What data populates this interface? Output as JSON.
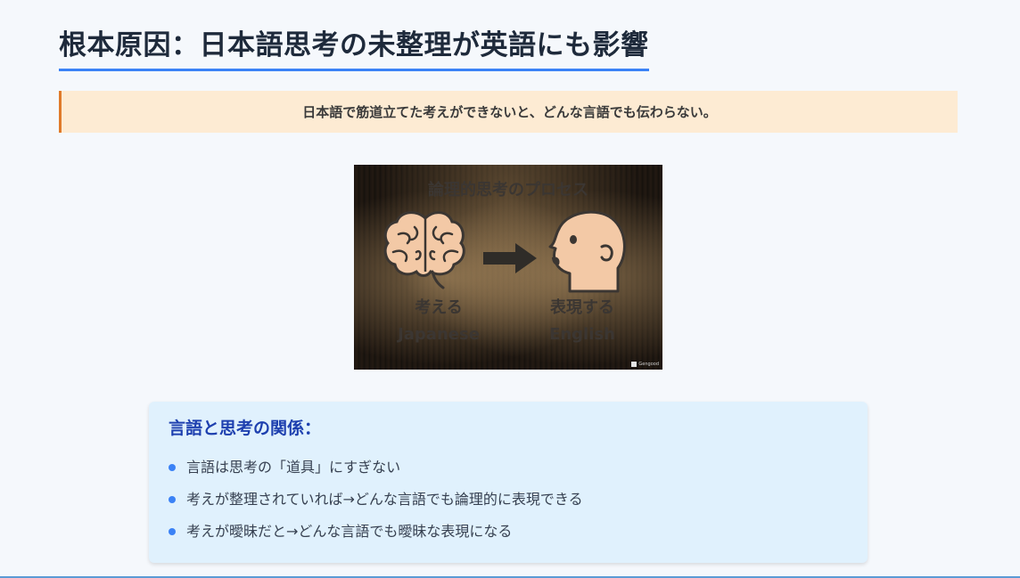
{
  "slide": {
    "title": "根本原因：日本語思考の未整理が英語にも影響",
    "callout": "日本語で筋道立てた考えができないと、どんな言語でも伝わらない。"
  },
  "figure": {
    "title": "論理的思考のプロセス",
    "left_label_jp": "考える",
    "left_label_en": "Japanese",
    "right_label_jp": "表現する",
    "right_label_en": "English",
    "badge": "Gengood",
    "icons": [
      "brain-icon",
      "arrow-right-icon",
      "speaking-head-icon"
    ]
  },
  "panel": {
    "title": "言語と思考の関係：",
    "items": [
      "言語は思考の「道具」にすぎない",
      "考えが整理されていれば→どんな言語でも論理的に表現できる",
      "考えが曖昧だと→どんな言語でも曖昧な表現になる"
    ]
  },
  "colors": {
    "accent": "#3b82f6",
    "callout_bg": "#fdebd3",
    "callout_border": "#e07a2a",
    "panel_bg": "#e0f1fd",
    "panel_title": "#1e40af"
  }
}
